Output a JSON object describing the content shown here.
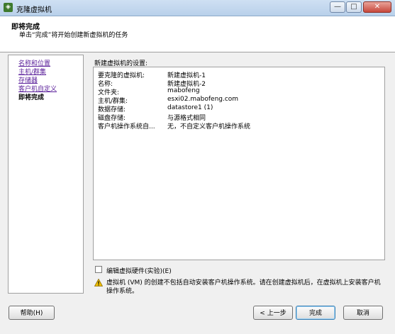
{
  "window": {
    "title": "克隆虚拟机",
    "minimize_glyph": "—",
    "maximize_glyph": "□",
    "close_glyph": "✕"
  },
  "header": {
    "title": "即将完成",
    "description": "单击“完成”将开始创建新虚拟机的任务"
  },
  "nav": {
    "items": [
      {
        "label": "名称和位置",
        "active": false
      },
      {
        "label": "主机/群集",
        "active": false
      },
      {
        "label": "存储器",
        "active": false
      },
      {
        "label": "客户机自定义",
        "active": false
      },
      {
        "label": "即将完成",
        "active": true
      }
    ]
  },
  "settings": {
    "title": "新建虚拟机的设置:",
    "rows": [
      {
        "key": "要克隆的虚拟机:",
        "value": "新建虚拟机-1"
      },
      {
        "key": "名称:",
        "value": "新建虚拟机-2"
      },
      {
        "key": "文件夹:",
        "value": "mabofeng"
      },
      {
        "key": "主机/群集:",
        "value": "esxi02.mabofeng.com"
      },
      {
        "key": "数据存储:",
        "value": "datastore1 (1)"
      },
      {
        "key": "磁盘存储:",
        "value": "与源格式相同"
      },
      {
        "key": "客户机操作系统自...",
        "value": "无，不自定义客户机操作系统"
      }
    ]
  },
  "edit_hardware": {
    "label": "编辑虚拟硬件(实验)(E)",
    "checked": false
  },
  "warning": {
    "text": "虚拟机 (VM) 的创建不包括自动安装客户机操作系统。请在创建虚拟机后，在虚拟机上安装客户机操作系统。"
  },
  "buttons": {
    "help": "帮助(H)",
    "back": "< 上一步",
    "finish": "完成",
    "cancel": "取消"
  },
  "colors": {
    "link": "#5a1f9a",
    "warning": "#e8b400"
  }
}
